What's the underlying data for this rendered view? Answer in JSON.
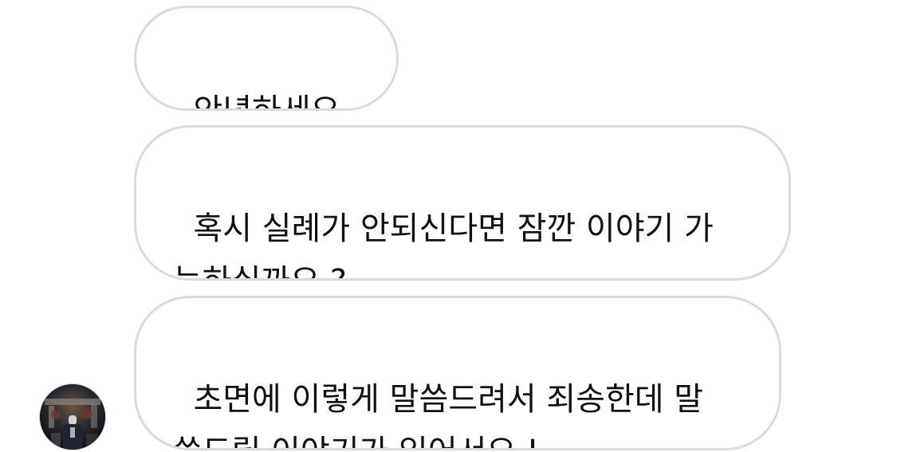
{
  "messages": [
    {
      "text": "안녕하세요 !"
    },
    {
      "text": "혹시 실례가 안되신다면 잠깐 이야기 가\n능하실까요 ?"
    },
    {
      "text": "초면에 이렇게 말씀드려서 죄송한데 말\n씀드릴 이야기가 있어서요 !"
    }
  ],
  "sender": {
    "avatar_icon": "profile-photo-avatar"
  }
}
